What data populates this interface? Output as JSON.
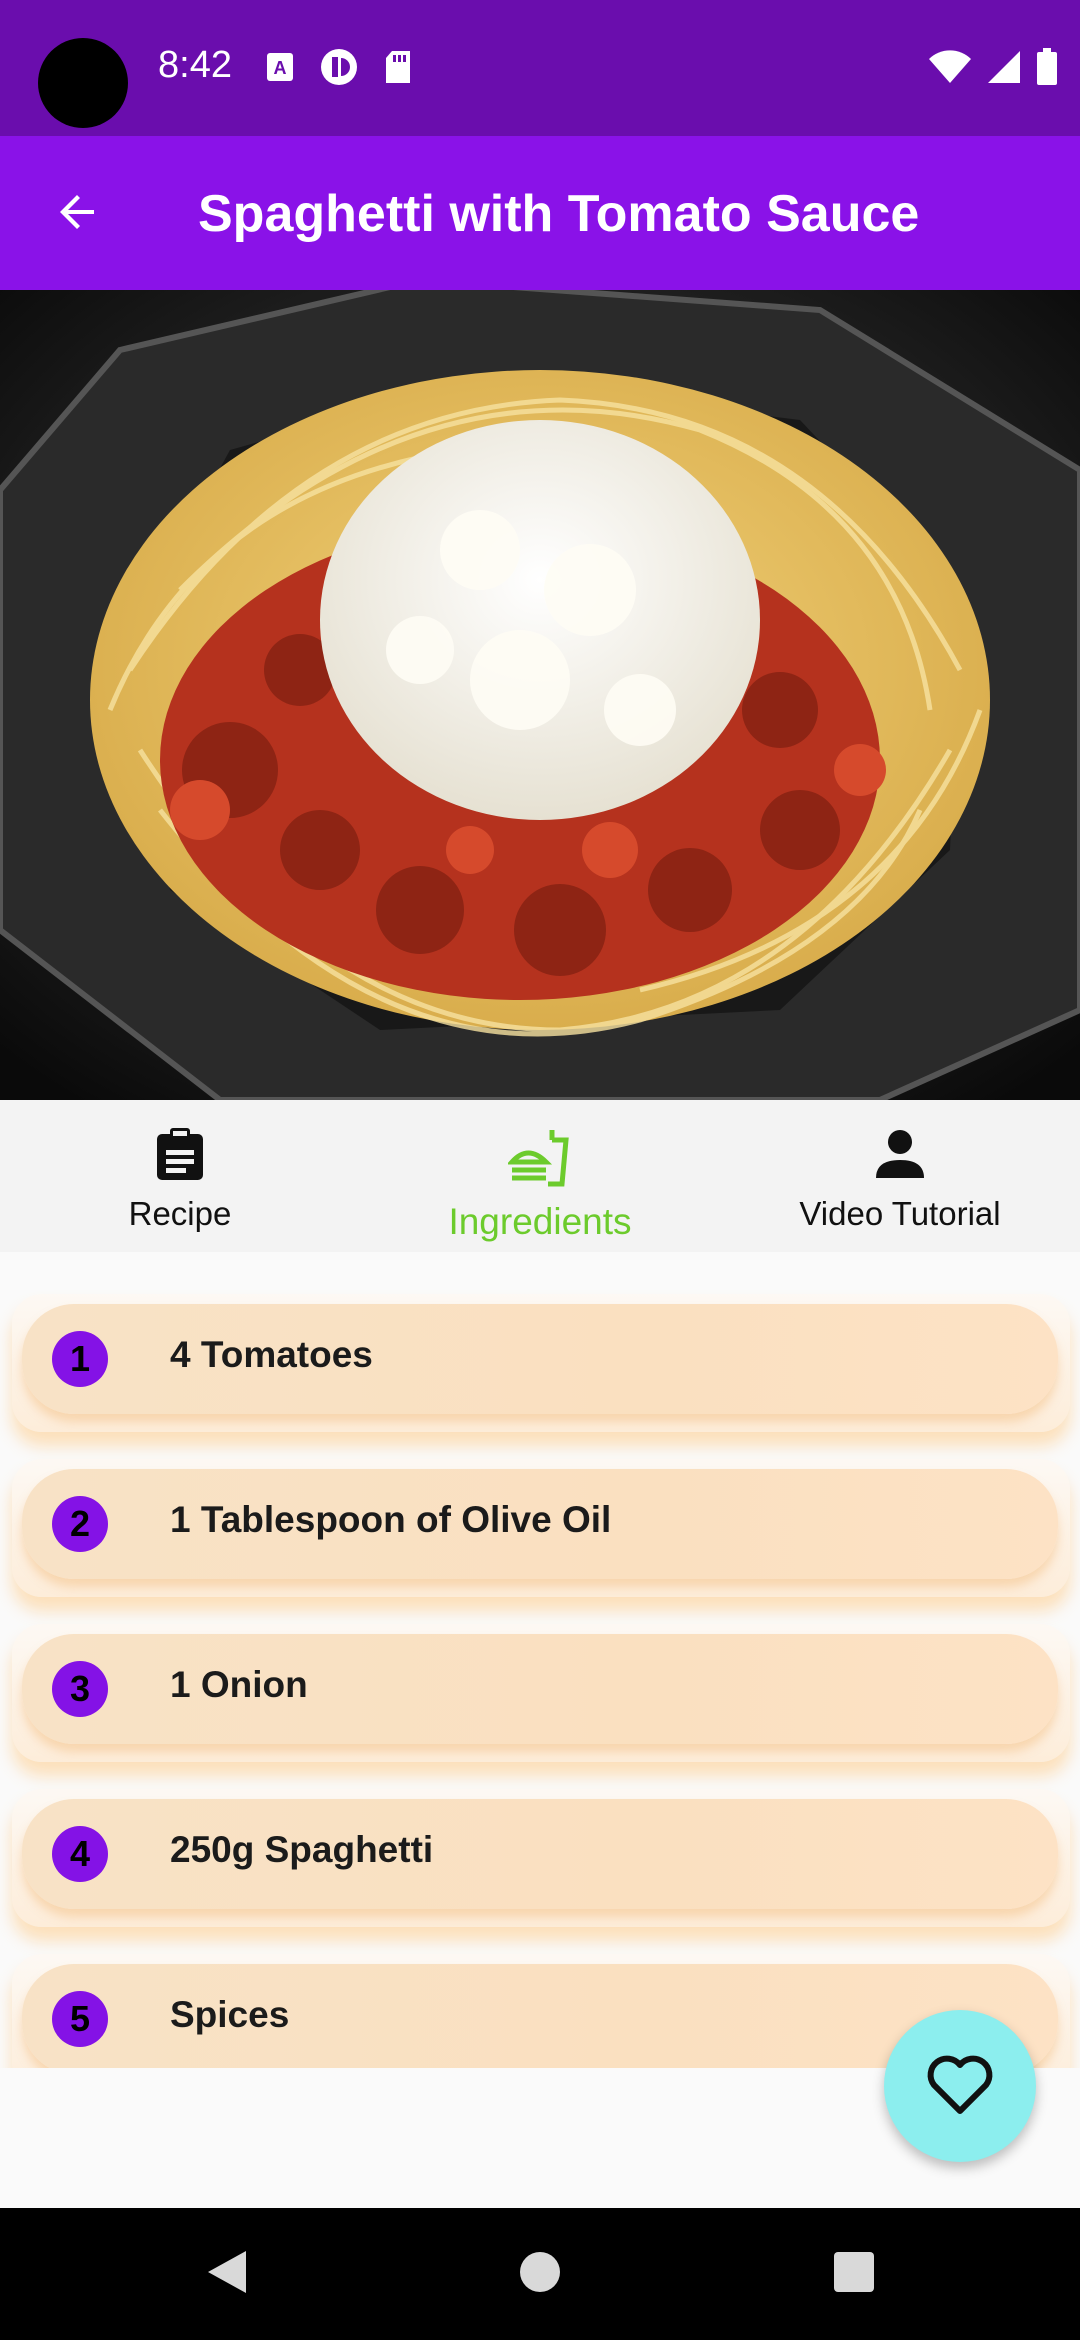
{
  "status_bar": {
    "time": "8:42",
    "left_icons": [
      "text-a-icon",
      "play-protect-icon",
      "sd-card-icon"
    ],
    "right_icons": [
      "wifi-icon",
      "signal-icon",
      "battery-icon"
    ]
  },
  "app_bar": {
    "title": "Spaghetti with Tomato Sauce",
    "back_icon": "arrow-back-icon"
  },
  "hero_image": {
    "description_icon": "spaghetti-photo"
  },
  "tabs": [
    {
      "label": "Recipe",
      "icon": "clipboard-icon",
      "active": false
    },
    {
      "label": "Ingredients",
      "icon": "fastfood-icon",
      "active": true
    },
    {
      "label": "Video Tutorial",
      "icon": "person-icon",
      "active": false
    }
  ],
  "ingredients": [
    {
      "number": "1",
      "text": "4 Tomatoes"
    },
    {
      "number": "2",
      "text": "1 Tablespoon of Olive Oil"
    },
    {
      "number": "3",
      "text": "1 Onion"
    },
    {
      "number": "4",
      "text": "250g Spaghetti"
    },
    {
      "number": "5",
      "text": "Spices"
    }
  ],
  "fab": {
    "icon": "heart-outline-icon"
  },
  "colors": {
    "status_bar": "#6a0dad",
    "app_bar": "#8a12e8",
    "active_tab": "#6ccb2c",
    "badge": "#8412e6",
    "fab": "#8ceeee"
  }
}
